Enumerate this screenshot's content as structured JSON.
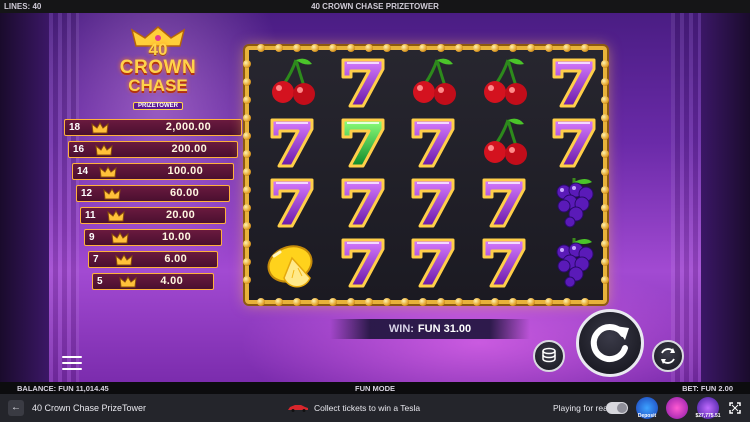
{
  "topbar": {
    "lines": "LINES: 40",
    "title": "40 CROWN CHASE PRIZETOWER"
  },
  "logo": {
    "number": "40",
    "word1": "CROWN",
    "word2": "CHASE",
    "sub": "PRIZETOWER"
  },
  "ladder": [
    {
      "count": "18",
      "value": "2,000.00"
    },
    {
      "count": "16",
      "value": "200.00"
    },
    {
      "count": "14",
      "value": "100.00"
    },
    {
      "count": "12",
      "value": "60.00"
    },
    {
      "count": "11",
      "value": "20.00"
    },
    {
      "count": "9",
      "value": "10.00"
    },
    {
      "count": "7",
      "value": "6.00"
    },
    {
      "count": "5",
      "value": "4.00"
    }
  ],
  "reels": [
    [
      "cherry",
      "seven-purple",
      "cherry",
      "cherry",
      "seven-purple"
    ],
    [
      "seven-purple",
      "seven-green",
      "seven-purple",
      "cherry",
      "seven-purple"
    ],
    [
      "seven-purple",
      "seven-purple",
      "seven-purple",
      "seven-purple",
      "grapes"
    ],
    [
      "lemon",
      "seven-purple",
      "seven-purple",
      "seven-purple",
      "grapes"
    ]
  ],
  "win": {
    "label": "WIN:",
    "value": "FUN 31.00"
  },
  "infobar": {
    "balance": "BALANCE: FUN 11,014.45",
    "mode": "FUN MODE",
    "bet": "BET: FUN 2.00"
  },
  "bottombar": {
    "back_glyph": "←",
    "game_title": "40 Crown Chase PrizeTower",
    "promo": "Collect tickets to win a Tesla",
    "play_real": "Playing for real",
    "badge1": "Deposit",
    "badge2": "",
    "badge3": "$27,775.51"
  },
  "colors": {
    "gold": "#e8b23a",
    "purple": "#7a2bc2",
    "ladder_bg": "#5a1436"
  }
}
